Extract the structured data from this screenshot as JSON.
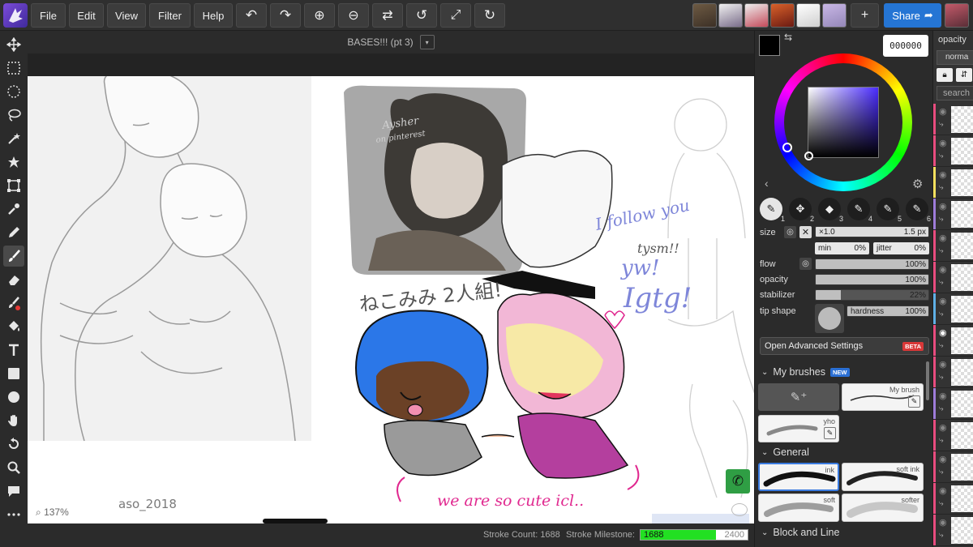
{
  "menu": {
    "file": "File",
    "edit": "Edit",
    "view": "View",
    "filter": "Filter",
    "help": "Help"
  },
  "share_label": "Share",
  "document": {
    "title": "BASES!!! (pt 3)"
  },
  "zoom": "137%",
  "status": {
    "stroke_count_label": "Stroke Count: 1688",
    "milestone_label": "Stroke Milestone:",
    "milestone_value": "1688",
    "milestone_target": "2400",
    "milestone_progress": 0.703
  },
  "color": {
    "hex_display": "000000",
    "primary": "#000000",
    "secondary": "#2b2b2b"
  },
  "layer_panel": {
    "opacity_label": "opacity",
    "blend_mode": "norma",
    "search_placeholder": "search"
  },
  "brush_slots": [
    "1",
    "2",
    "3",
    "4",
    "5",
    "6"
  ],
  "brush_settings": {
    "size_label": "size",
    "size_multiplier": "×1.0",
    "size_value": "1.5 px",
    "min_label": "min",
    "min_value": "0%",
    "jitter_label": "jitter",
    "jitter_value": "0%",
    "flow_label": "flow",
    "flow_value": "100%",
    "flow_level": 1.0,
    "opacity_label": "opacity",
    "opacity_value": "100%",
    "opacity_level": 1.0,
    "stabilizer_label": "stabilizer",
    "stabilizer_value": "22%",
    "stabilizer_level": 0.22,
    "tip_shape_label": "tip shape",
    "hardness_label": "hardness",
    "hardness_value": "100%",
    "advanced_button": "Open Advanced Settings",
    "beta_badge": "BETA"
  },
  "brush_library": {
    "my_brushes_title": "My brushes",
    "new_badge": "NEW",
    "my_brushes": [
      "My brush",
      "yho"
    ],
    "general_title": "General",
    "general": [
      "ink",
      "soft ink",
      "soft",
      "softer"
    ],
    "block_title": "Block and Line"
  },
  "canvas_text": {
    "watermark": "aso_2018",
    "sticker_text_1": "Aysher on pinterest",
    "note_1": "I follow you",
    "note_2": "tysm!!",
    "note_3": "yw!",
    "note_4": "Igtg!",
    "note_5": "ねこみみ 2人組!",
    "caption": "we are so cute icl.."
  },
  "icons": {
    "undo": "↶",
    "redo": "↷",
    "zoom_in": "⊕",
    "zoom_out": "⊖",
    "swap": "⇄",
    "rotate_left": "↺",
    "fullscreen": "⤢",
    "rotate_right": "↻",
    "add_user": "+",
    "share": "➦",
    "phone": "✆"
  }
}
